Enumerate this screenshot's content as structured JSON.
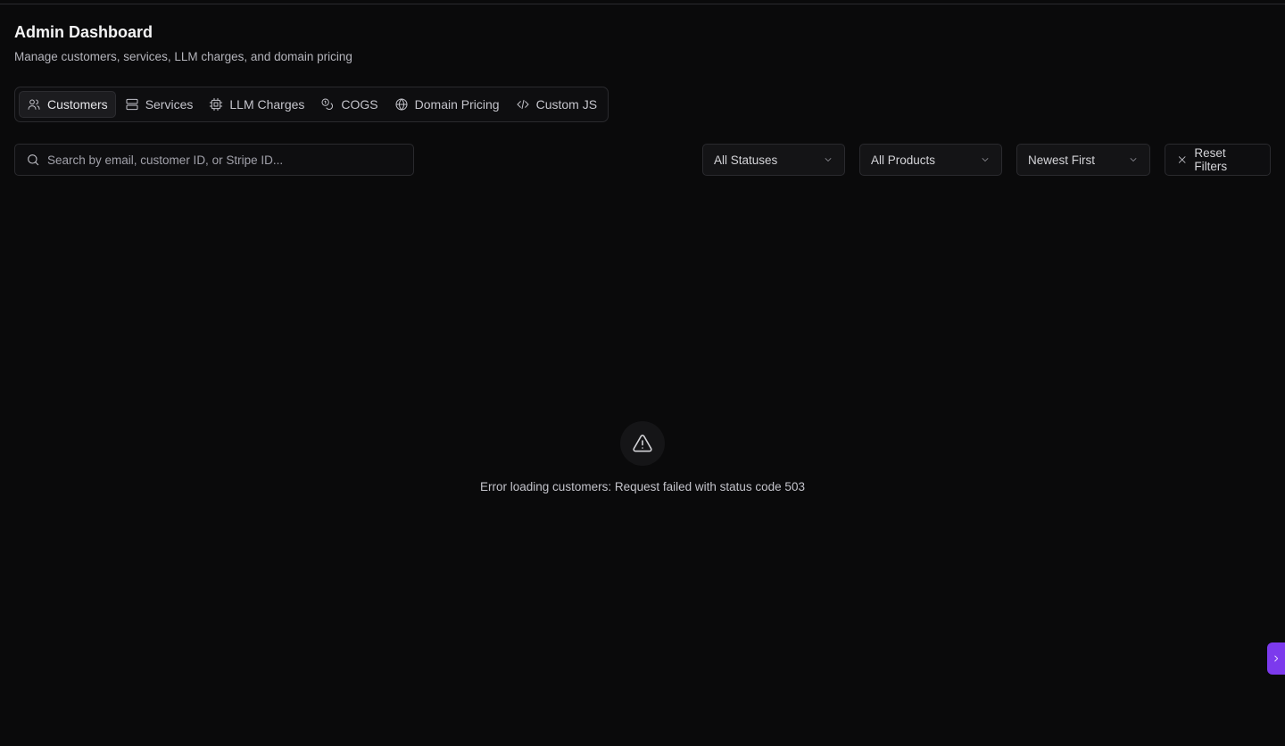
{
  "header": {
    "title": "Admin Dashboard",
    "subtitle": "Manage customers, services, LLM charges, and domain pricing"
  },
  "tabs": [
    {
      "label": "Customers",
      "icon": "users-icon",
      "active": true
    },
    {
      "label": "Services",
      "icon": "server-icon",
      "active": false
    },
    {
      "label": "LLM Charges",
      "icon": "cpu-icon",
      "active": false
    },
    {
      "label": "COGS",
      "icon": "coins-icon",
      "active": false
    },
    {
      "label": "Domain Pricing",
      "icon": "globe-icon",
      "active": false
    },
    {
      "label": "Custom JS",
      "icon": "code-icon",
      "active": false
    }
  ],
  "filters": {
    "search_placeholder": "Search by email, customer ID, or Stripe ID...",
    "status": "All Statuses",
    "product": "All Products",
    "sort": "Newest First",
    "reset_label": "Reset Filters"
  },
  "error": {
    "icon": "warning-triangle-icon",
    "message": "Error loading customers: Request failed with status code 503"
  },
  "colors": {
    "background": "#0a0a0b",
    "accent": "#7c3aed"
  }
}
